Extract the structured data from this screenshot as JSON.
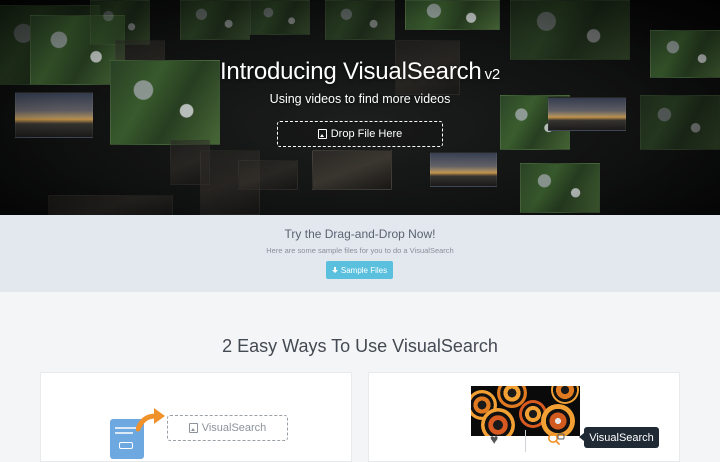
{
  "hero": {
    "title": "Introducing VisualSearch",
    "version": "v2",
    "subtitle": "Using videos to find more videos",
    "drop_label": "Drop File Here"
  },
  "try_section": {
    "title": "Try the Drag-and-Drop Now!",
    "subtitle": "Here are some sample files for you to do a VisualSearch",
    "sample_button": "Sample Files"
  },
  "ways": {
    "title": "2 Easy Ways To Use VisualSearch",
    "card1": {
      "box_label": "VisualSearch"
    },
    "card2": {
      "tooltip": "VisualSearch"
    }
  },
  "colors": {
    "accent": "#5bc0de",
    "arrow": "#f0922b",
    "doc": "#6ea8e0",
    "tooltip_bg": "#1f2a35"
  },
  "icons": [
    "image-icon",
    "download-icon",
    "heart-icon",
    "visual-search-icon",
    "arrow-icon",
    "document-icon"
  ]
}
